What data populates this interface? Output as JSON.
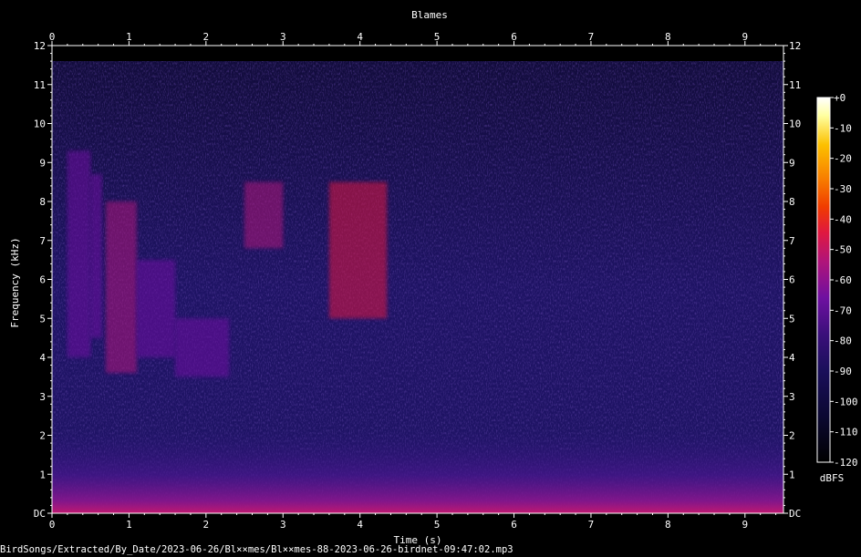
{
  "chart_data": {
    "type": "heatmap",
    "title": "Blames",
    "xlabel": "Time (s)",
    "ylabel": "Frequency (kHz)",
    "xlim": [
      0,
      9.5
    ],
    "ylim": [
      0,
      12
    ],
    "x_ticks": [
      "0",
      "1",
      "2",
      "3",
      "4",
      "5",
      "6",
      "7",
      "8",
      "9"
    ],
    "y_ticks": [
      "DC",
      "1",
      "2",
      "3",
      "4",
      "5",
      "6",
      "7",
      "8",
      "9",
      "10",
      "11",
      "12"
    ],
    "colorbar": {
      "label": "dBFS",
      "ticks": [
        "+0",
        "-10",
        "-20",
        "-30",
        "-40",
        "-50",
        "-60",
        "-70",
        "-80",
        "-90",
        "-100",
        "-110",
        "-120"
      ],
      "range": [
        -120,
        0
      ]
    },
    "background_level_dbfs": -95,
    "low_band_level_dbfs": -75,
    "calls": [
      {
        "t0": 0.2,
        "t1": 0.5,
        "f0": 4.0,
        "f1": 9.3,
        "level_dbfs": -78
      },
      {
        "t0": 0.5,
        "t1": 0.65,
        "f0": 4.5,
        "f1": 8.7,
        "level_dbfs": -72
      },
      {
        "t0": 0.7,
        "t1": 1.1,
        "f0": 3.6,
        "f1": 8.0,
        "level_dbfs": -68
      },
      {
        "t0": 1.1,
        "t1": 1.6,
        "f0": 4.0,
        "f1": 6.5,
        "level_dbfs": -75
      },
      {
        "t0": 1.6,
        "t1": 2.3,
        "f0": 3.5,
        "f1": 5.0,
        "level_dbfs": -72
      },
      {
        "t0": 2.5,
        "t1": 3.0,
        "f0": 6.8,
        "f1": 8.5,
        "level_dbfs": -65
      },
      {
        "t0": 3.6,
        "t1": 4.35,
        "f0": 5.0,
        "f1": 8.5,
        "level_dbfs": -60
      }
    ],
    "grid": false,
    "legend": "colorbar-right"
  },
  "file_path": "BirdSongs/Extracted/By_Date/2023-06-26/Bl××mes/Bl××mes-88-2023-06-26-birdnet-09:47:02.mp3",
  "colors": {
    "background": "#000000",
    "text": "#ffffff",
    "colormap": [
      "#000000",
      "#0b0830",
      "#1a0f5a",
      "#3a0f7a",
      "#6e10a0",
      "#b0147a",
      "#e01840",
      "#f03c00",
      "#f88000",
      "#fcc000",
      "#ffffa0",
      "#ffffff"
    ]
  }
}
